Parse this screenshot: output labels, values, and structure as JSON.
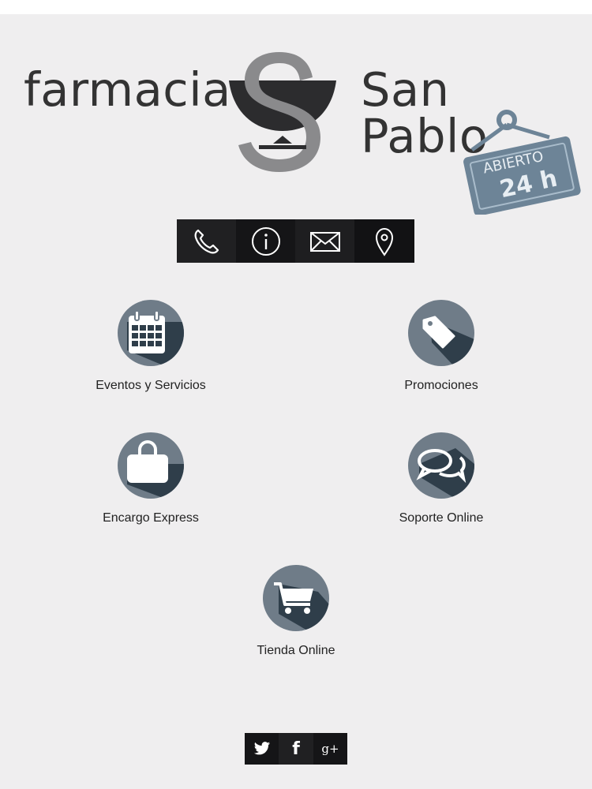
{
  "brand": {
    "word_left": "farmacia",
    "word_right": "San Pablo",
    "sign_line1": "ABIERTO",
    "sign_line2": "24 h"
  },
  "contact_bar": [
    {
      "icon": "phone-icon"
    },
    {
      "icon": "info-icon"
    },
    {
      "icon": "mail-icon"
    },
    {
      "icon": "location-pin-icon"
    }
  ],
  "menu": {
    "eventos": "Eventos y Servicios",
    "promociones": "Promociones",
    "encargo": "Encargo Express",
    "soporte": "Soporte Online",
    "tienda": "Tienda Online"
  },
  "social": {
    "twitter_icon": "twitter-icon",
    "facebook_glyph": "f",
    "googleplus_glyph": "g+"
  },
  "colors": {
    "background": "#efeeef",
    "circle": "#6f7c88",
    "circle_shadow": "#2f3e4a",
    "bar": "#151517",
    "sign": "#6d8497"
  }
}
